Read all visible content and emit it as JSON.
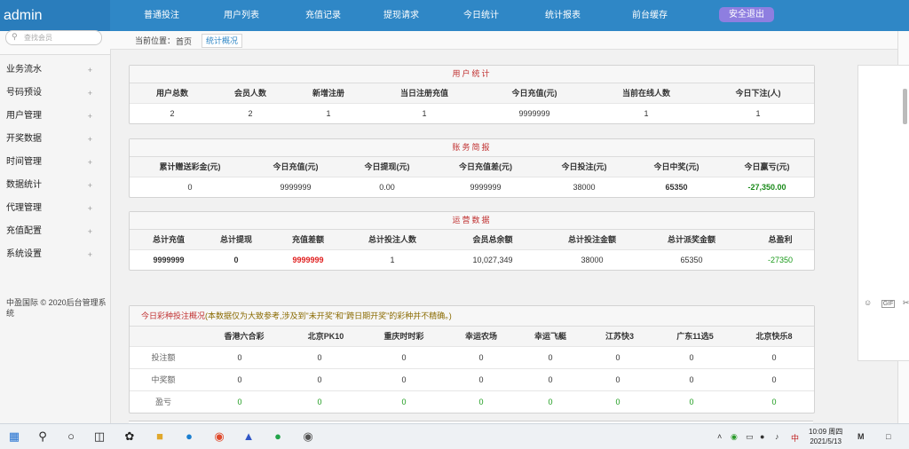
{
  "app": {
    "title": "admin"
  },
  "topnav": {
    "items": [
      "普通投注",
      "用户列表",
      "充值记录",
      "提现请求",
      "今日统计",
      "统计报表",
      "前台缓存"
    ],
    "logout_label": "安全退出"
  },
  "sidebar": {
    "search_placeholder": "查找会员",
    "items": [
      "业务流水",
      "号码预设",
      "用户管理",
      "开奖数据",
      "时间管理",
      "数据统计",
      "代理管理",
      "充值配置",
      "系统设置"
    ],
    "plus": "+",
    "copyright": "中盈国际 © 2020后台管理系统"
  },
  "breadcrumb": {
    "label": "当前位置：",
    "home": "首页",
    "current": "统计概况"
  },
  "user_stats": {
    "title": "用户统计",
    "headers": [
      "用户总数",
      "会员人数",
      "新增注册",
      "当日注册充值",
      "今日充值(元)",
      "当前在线人数",
      "今日下注(人)"
    ],
    "values": [
      "2",
      "2",
      "1",
      "1",
      "9999999",
      "1",
      "1"
    ]
  },
  "finance": {
    "title": "账务简报",
    "headers": [
      "累计赠送彩金(元)",
      "今日充值(元)",
      "今日提现(元)",
      "今日充值差(元)",
      "今日投注(元)",
      "今日中奖(元)",
      "今日赢亏(元)"
    ],
    "values": [
      "0",
      "9999999",
      "0.00",
      "9999999",
      "38000",
      "65350",
      "-27,350.00"
    ]
  },
  "operations": {
    "title": "运营数据",
    "headers": [
      "总计充值",
      "总计提现",
      "充值差额",
      "总计投注人数",
      "会员总余额",
      "总计投注金额",
      "总计派奖金额",
      "总盈利"
    ],
    "values": [
      "9999999",
      "0",
      "9999999",
      "1",
      "10,027,349",
      "38000",
      "65350",
      "-27350"
    ]
  },
  "lottery": {
    "title": "今日彩种投注概况",
    "note": "(本数据仅为大致参考,涉及到\"未开奖\"和\"跨日期开奖\"的彩种并不精确。)",
    "columns": [
      "香港六合彩",
      "北京PK10",
      "重庆时时彩",
      "幸运农场",
      "幸运飞艇",
      "江苏快3",
      "广东11选5",
      "北京快乐8"
    ],
    "rows": [
      {
        "label": "投注额",
        "values": [
          "0",
          "0",
          "0",
          "0",
          "0",
          "0",
          "0",
          "0"
        ]
      },
      {
        "label": "中奖额",
        "values": [
          "0",
          "0",
          "0",
          "0",
          "0",
          "0",
          "0",
          "0"
        ]
      },
      {
        "label": "盈亏",
        "values": [
          "0",
          "0",
          "0",
          "0",
          "0",
          "0",
          "0",
          "0"
        ]
      }
    ]
  },
  "right_panel": {
    "gif_label": "GIF"
  },
  "taskbar": {
    "time": "10:09 周四",
    "date": "2021/5/13",
    "tray_lang": "中",
    "tray_ime": "M"
  },
  "colors": {
    "header": "#2f87c6",
    "logout": "#8e7ee0",
    "title_red": "#c03030",
    "loss_green": "#1a9a1a"
  }
}
